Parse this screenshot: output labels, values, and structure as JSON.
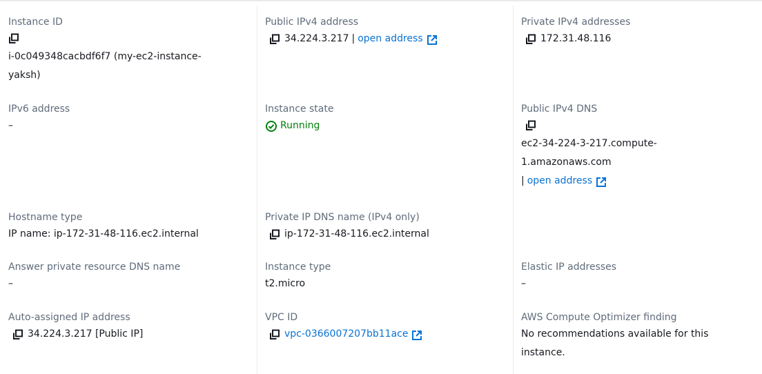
{
  "col1": {
    "instance_id_label": "Instance ID",
    "instance_id_value_line1": "i-0c049348cacbdf6f7 (my-ec2-instance-",
    "instance_id_value_line2": "yaksh)",
    "ipv6_label": "IPv6 address",
    "ipv6_value": "–",
    "hostname_type_label": "Hostname type",
    "hostname_type_value": "IP name: ip-172-31-48-116.ec2.internal",
    "answer_dns_label": "Answer private resource DNS name",
    "answer_dns_value": "–",
    "auto_ip_label": "Auto-assigned IP address",
    "auto_ip_value": "34.224.3.217 [Public IP]"
  },
  "col2": {
    "public_ipv4_label": "Public IPv4 address",
    "public_ipv4_value": "34.224.3.217",
    "public_ipv4_separator": "|",
    "public_ipv4_link": "open address",
    "instance_state_label": "Instance state",
    "instance_state_value": "Running",
    "private_dns_label": "Private IP DNS name (IPv4 only)",
    "private_dns_value": "ip-172-31-48-116.ec2.internal",
    "instance_type_label": "Instance type",
    "instance_type_value": "t2.micro",
    "vpc_label": "VPC ID",
    "vpc_value": "vpc-0366007207bb11ace"
  },
  "col3": {
    "private_ipv4_label": "Private IPv4 addresses",
    "private_ipv4_value": "172.31.48.116",
    "public_dns_label": "Public IPv4 DNS",
    "public_dns_line1": "ec2-34-224-3-217.compute-",
    "public_dns_line2": "1.amazonaws.com",
    "public_dns_separator": "|",
    "public_dns_link": "open address",
    "elastic_ip_label": "Elastic IP addresses",
    "elastic_ip_value": "–",
    "optimizer_label": "AWS Compute Optimizer finding",
    "optimizer_line1": "No recommendations available for this",
    "optimizer_line2": "instance."
  },
  "colors": {
    "link": "#0972d3",
    "success": "#037f0c",
    "label": "#5f6b7a",
    "text": "#16191f"
  },
  "icons": {
    "copy": "copy-icon",
    "external": "external-link-icon",
    "status": "check-circle-icon"
  }
}
